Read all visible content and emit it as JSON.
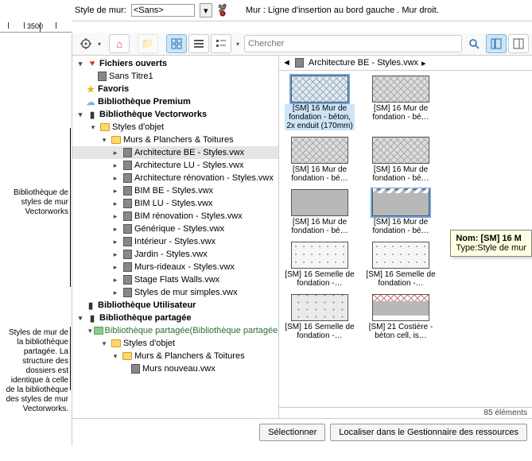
{
  "topbar": {
    "style_label": "Style de mur:",
    "style_value": "<Sans>",
    "status": "Mur : Ligne d'insertion au bord gauche . Mur droit."
  },
  "ruler": {
    "value": "3500"
  },
  "notes": {
    "n1": "Bibliothèque de styles de mur Vectorworks",
    "n2": "Styles de mur de la bibliothèque partagée. La structure des dossiers est identique à celle de la bibliothèque des styles de mur Vectorworks."
  },
  "search": {
    "placeholder": "Chercher"
  },
  "tree": {
    "open_files": "Fichiers ouverts",
    "untitled": "Sans Titre1",
    "favorites": "Favoris",
    "premium": "Bibliothèque Premium",
    "vw_lib": "Bibliothèque Vectorworks",
    "obj_styles": "Styles d'objet",
    "walls_cat": "Murs & Planchers & Toitures",
    "files": [
      "Architecture BE - Styles.vwx",
      "Architecture LU - Styles.vwx",
      "Architecture rénovation - Styles.vwx",
      "BIM BE - Styles.vwx",
      "BIM LU - Styles.vwx",
      "BIM rénovation - Styles.vwx",
      "Générique - Styles.vwx",
      "Intérieur - Styles.vwx",
      "Jardin - Styles.vwx",
      "Murs-rideaux - Styles.vwx",
      "Stage Flats Walls.vwx",
      "Styles de mur simples.vwx"
    ],
    "user_lib": "Bibliothèque Utilisateur",
    "shared_lib": "Bibliothèque partagée",
    "shared_sub": "Bibliothèque partagée(Bibliothèque partagée)",
    "shared_styles": "Styles d'objet",
    "shared_walls": "Murs & Planchers & Toitures",
    "shared_file": "Murs nouveau.vwx"
  },
  "crumb": {
    "text": "Architecture BE - Styles.vwx"
  },
  "thumbs": [
    {
      "label": "[SM] 16 Mur de fondation - béton, 2x enduit (170mm)",
      "cls": "hatch-cross",
      "sel": true
    },
    {
      "label": "[SM] 16 Mur de fondation - bé…",
      "cls": "hatch-cross"
    },
    {
      "label": "[SM] 16 Mur de fondation - bé…",
      "cls": "hatch-cross"
    },
    {
      "label": "[SM] 16 Mur de fondation - bé…",
      "cls": "hatch-cross"
    },
    {
      "label": "[SM] 16 Mur de fondation - bé…",
      "cls": "hatch-grey"
    },
    {
      "label": "[SM] 16 Mur de fondation - bé…",
      "cls": "hatch-saw",
      "sel2": true
    },
    {
      "label": "[SM] 16 Semelle de fondation -…",
      "cls": "hatch-dots"
    },
    {
      "label": "[SM] 16 Semelle de fondation -…",
      "cls": "hatch-dots"
    },
    {
      "label": "[SM] 16 Semelle de fondation -…",
      "cls": "hatch-concrete"
    },
    {
      "label": "[SM] 21 Costière - béton cell, is…",
      "cls": "hatch-band"
    }
  ],
  "tooltip": {
    "title": "Nom: [SM] 16 M",
    "type": "Type:Style de mur"
  },
  "count": "85 éléments",
  "buttons": {
    "select": "Sélectionner",
    "locate": "Localiser dans le Gestionnaire des ressources"
  }
}
